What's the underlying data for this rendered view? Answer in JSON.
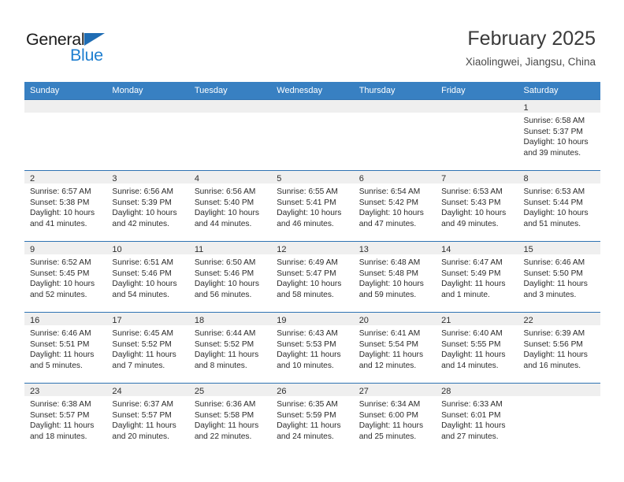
{
  "brand": {
    "name_part1": "General",
    "name_part2": "Blue",
    "triangle_color": "#1f6db4",
    "blue_color": "#1f7fd0"
  },
  "header": {
    "title": "February 2025",
    "subtitle": "Xiaolingwei, Jiangsu, China"
  },
  "theme": {
    "header_bar_color": "#3880c2",
    "row_divider_color": "#2f73b3",
    "daynum_band_color": "#efefef"
  },
  "weekdays": [
    "Sunday",
    "Monday",
    "Tuesday",
    "Wednesday",
    "Thursday",
    "Friday",
    "Saturday"
  ],
  "weeks": [
    [
      {
        "day": "",
        "sunrise": "",
        "sunset": "",
        "daylight1": "",
        "daylight2": ""
      },
      {
        "day": "",
        "sunrise": "",
        "sunset": "",
        "daylight1": "",
        "daylight2": ""
      },
      {
        "day": "",
        "sunrise": "",
        "sunset": "",
        "daylight1": "",
        "daylight2": ""
      },
      {
        "day": "",
        "sunrise": "",
        "sunset": "",
        "daylight1": "",
        "daylight2": ""
      },
      {
        "day": "",
        "sunrise": "",
        "sunset": "",
        "daylight1": "",
        "daylight2": ""
      },
      {
        "day": "",
        "sunrise": "",
        "sunset": "",
        "daylight1": "",
        "daylight2": ""
      },
      {
        "day": "1",
        "sunrise": "Sunrise: 6:58 AM",
        "sunset": "Sunset: 5:37 PM",
        "daylight1": "Daylight: 10 hours",
        "daylight2": "and 39 minutes."
      }
    ],
    [
      {
        "day": "2",
        "sunrise": "Sunrise: 6:57 AM",
        "sunset": "Sunset: 5:38 PM",
        "daylight1": "Daylight: 10 hours",
        "daylight2": "and 41 minutes."
      },
      {
        "day": "3",
        "sunrise": "Sunrise: 6:56 AM",
        "sunset": "Sunset: 5:39 PM",
        "daylight1": "Daylight: 10 hours",
        "daylight2": "and 42 minutes."
      },
      {
        "day": "4",
        "sunrise": "Sunrise: 6:56 AM",
        "sunset": "Sunset: 5:40 PM",
        "daylight1": "Daylight: 10 hours",
        "daylight2": "and 44 minutes."
      },
      {
        "day": "5",
        "sunrise": "Sunrise: 6:55 AM",
        "sunset": "Sunset: 5:41 PM",
        "daylight1": "Daylight: 10 hours",
        "daylight2": "and 46 minutes."
      },
      {
        "day": "6",
        "sunrise": "Sunrise: 6:54 AM",
        "sunset": "Sunset: 5:42 PM",
        "daylight1": "Daylight: 10 hours",
        "daylight2": "and 47 minutes."
      },
      {
        "day": "7",
        "sunrise": "Sunrise: 6:53 AM",
        "sunset": "Sunset: 5:43 PM",
        "daylight1": "Daylight: 10 hours",
        "daylight2": "and 49 minutes."
      },
      {
        "day": "8",
        "sunrise": "Sunrise: 6:53 AM",
        "sunset": "Sunset: 5:44 PM",
        "daylight1": "Daylight: 10 hours",
        "daylight2": "and 51 minutes."
      }
    ],
    [
      {
        "day": "9",
        "sunrise": "Sunrise: 6:52 AM",
        "sunset": "Sunset: 5:45 PM",
        "daylight1": "Daylight: 10 hours",
        "daylight2": "and 52 minutes."
      },
      {
        "day": "10",
        "sunrise": "Sunrise: 6:51 AM",
        "sunset": "Sunset: 5:46 PM",
        "daylight1": "Daylight: 10 hours",
        "daylight2": "and 54 minutes."
      },
      {
        "day": "11",
        "sunrise": "Sunrise: 6:50 AM",
        "sunset": "Sunset: 5:46 PM",
        "daylight1": "Daylight: 10 hours",
        "daylight2": "and 56 minutes."
      },
      {
        "day": "12",
        "sunrise": "Sunrise: 6:49 AM",
        "sunset": "Sunset: 5:47 PM",
        "daylight1": "Daylight: 10 hours",
        "daylight2": "and 58 minutes."
      },
      {
        "day": "13",
        "sunrise": "Sunrise: 6:48 AM",
        "sunset": "Sunset: 5:48 PM",
        "daylight1": "Daylight: 10 hours",
        "daylight2": "and 59 minutes."
      },
      {
        "day": "14",
        "sunrise": "Sunrise: 6:47 AM",
        "sunset": "Sunset: 5:49 PM",
        "daylight1": "Daylight: 11 hours",
        "daylight2": "and 1 minute."
      },
      {
        "day": "15",
        "sunrise": "Sunrise: 6:46 AM",
        "sunset": "Sunset: 5:50 PM",
        "daylight1": "Daylight: 11 hours",
        "daylight2": "and 3 minutes."
      }
    ],
    [
      {
        "day": "16",
        "sunrise": "Sunrise: 6:46 AM",
        "sunset": "Sunset: 5:51 PM",
        "daylight1": "Daylight: 11 hours",
        "daylight2": "and 5 minutes."
      },
      {
        "day": "17",
        "sunrise": "Sunrise: 6:45 AM",
        "sunset": "Sunset: 5:52 PM",
        "daylight1": "Daylight: 11 hours",
        "daylight2": "and 7 minutes."
      },
      {
        "day": "18",
        "sunrise": "Sunrise: 6:44 AM",
        "sunset": "Sunset: 5:52 PM",
        "daylight1": "Daylight: 11 hours",
        "daylight2": "and 8 minutes."
      },
      {
        "day": "19",
        "sunrise": "Sunrise: 6:43 AM",
        "sunset": "Sunset: 5:53 PM",
        "daylight1": "Daylight: 11 hours",
        "daylight2": "and 10 minutes."
      },
      {
        "day": "20",
        "sunrise": "Sunrise: 6:41 AM",
        "sunset": "Sunset: 5:54 PM",
        "daylight1": "Daylight: 11 hours",
        "daylight2": "and 12 minutes."
      },
      {
        "day": "21",
        "sunrise": "Sunrise: 6:40 AM",
        "sunset": "Sunset: 5:55 PM",
        "daylight1": "Daylight: 11 hours",
        "daylight2": "and 14 minutes."
      },
      {
        "day": "22",
        "sunrise": "Sunrise: 6:39 AM",
        "sunset": "Sunset: 5:56 PM",
        "daylight1": "Daylight: 11 hours",
        "daylight2": "and 16 minutes."
      }
    ],
    [
      {
        "day": "23",
        "sunrise": "Sunrise: 6:38 AM",
        "sunset": "Sunset: 5:57 PM",
        "daylight1": "Daylight: 11 hours",
        "daylight2": "and 18 minutes."
      },
      {
        "day": "24",
        "sunrise": "Sunrise: 6:37 AM",
        "sunset": "Sunset: 5:57 PM",
        "daylight1": "Daylight: 11 hours",
        "daylight2": "and 20 minutes."
      },
      {
        "day": "25",
        "sunrise": "Sunrise: 6:36 AM",
        "sunset": "Sunset: 5:58 PM",
        "daylight1": "Daylight: 11 hours",
        "daylight2": "and 22 minutes."
      },
      {
        "day": "26",
        "sunrise": "Sunrise: 6:35 AM",
        "sunset": "Sunset: 5:59 PM",
        "daylight1": "Daylight: 11 hours",
        "daylight2": "and 24 minutes."
      },
      {
        "day": "27",
        "sunrise": "Sunrise: 6:34 AM",
        "sunset": "Sunset: 6:00 PM",
        "daylight1": "Daylight: 11 hours",
        "daylight2": "and 25 minutes."
      },
      {
        "day": "28",
        "sunrise": "Sunrise: 6:33 AM",
        "sunset": "Sunset: 6:01 PM",
        "daylight1": "Daylight: 11 hours",
        "daylight2": "and 27 minutes."
      },
      {
        "day": "",
        "sunrise": "",
        "sunset": "",
        "daylight1": "",
        "daylight2": ""
      }
    ]
  ]
}
